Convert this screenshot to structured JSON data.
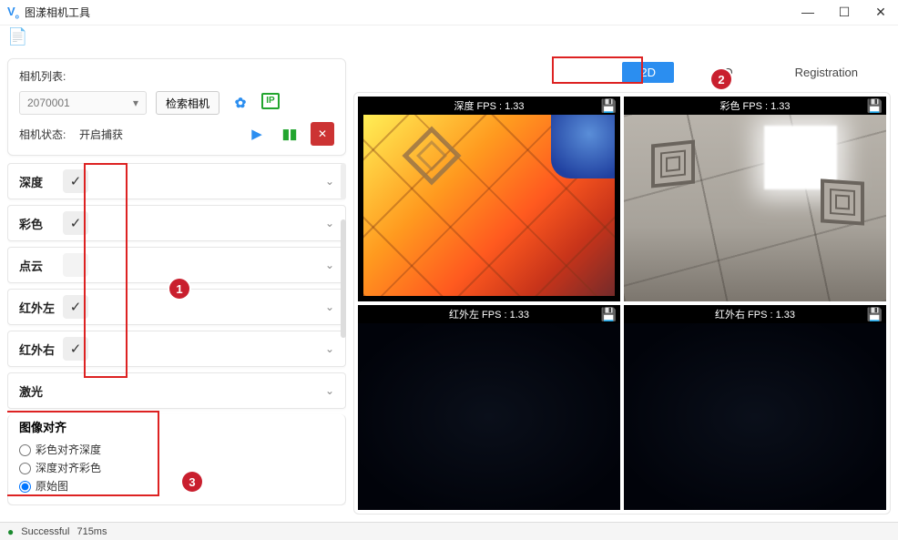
{
  "window": {
    "title": "图漾相机工具"
  },
  "toptabs": {
    "d2": "2D",
    "d3": "3D",
    "reg": "Registration",
    "active": "2D"
  },
  "panel": {
    "list_label": "相机列表:",
    "camera_id": "2070001",
    "search_btn": "检索相机",
    "status_label": "相机状态:",
    "status_value": "开启捕获"
  },
  "streams": [
    {
      "name": "深度",
      "enabled": true
    },
    {
      "name": "彩色",
      "enabled": true
    },
    {
      "name": "点云",
      "enabled": false
    },
    {
      "name": "红外左",
      "enabled": true
    },
    {
      "name": "红外右",
      "enabled": true
    },
    {
      "name": "激光",
      "enabled": null
    }
  ],
  "align": {
    "title": "图像对齐",
    "opt_color_to_depth": "彩色对齐深度",
    "opt_depth_to_color": "深度对齐彩色",
    "opt_raw": "原始图",
    "selected": "原始图"
  },
  "views": {
    "depth": {
      "hdr": "深度  FPS : 1.33"
    },
    "color": {
      "hdr": "彩色  FPS : 1.33"
    },
    "irl": {
      "hdr": "红外左  FPS : 1.33"
    },
    "irr": {
      "hdr": "红外右  FPS : 1.33"
    }
  },
  "status": {
    "text": "Successful",
    "latency": "715ms"
  },
  "annotations": {
    "a1": "1",
    "a2": "2",
    "a3": "3"
  }
}
